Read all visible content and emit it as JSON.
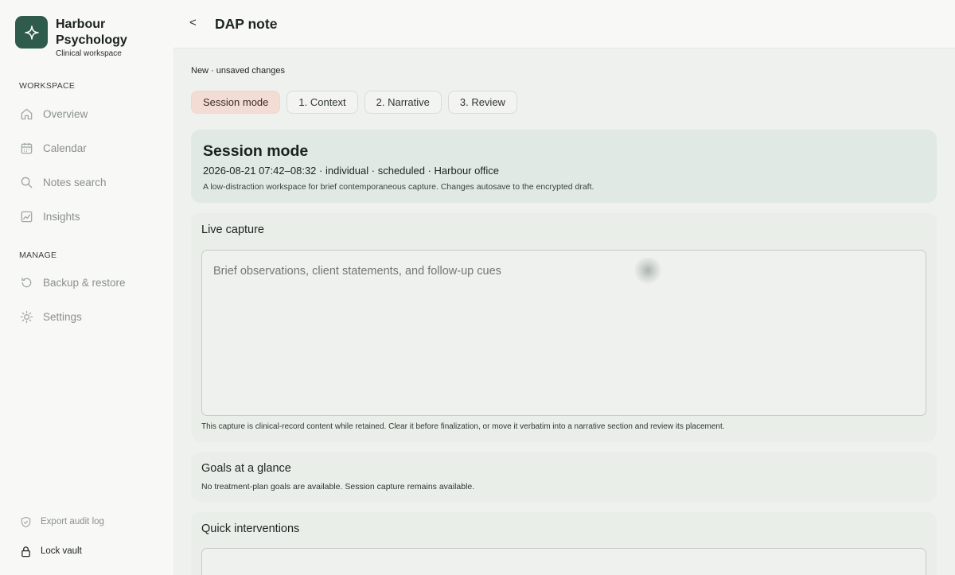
{
  "brand": {
    "name": "Harbour Psychology",
    "subtitle": "Clinical workspace",
    "logo_icon": "sparkle-icon",
    "logo_color": "#2f5b4d"
  },
  "sidebar": {
    "workspace_label": "WORKSPACE",
    "workspace_items": [
      {
        "label": "Overview",
        "icon": "home-icon"
      },
      {
        "label": "Calendar",
        "icon": "calendar-icon"
      },
      {
        "label": "Notes search",
        "icon": "search-icon"
      },
      {
        "label": "Insights",
        "icon": "chart-icon"
      }
    ],
    "manage_label": "MANAGE",
    "manage_items": [
      {
        "label": "Backup & restore",
        "icon": "restore-icon"
      },
      {
        "label": "Settings",
        "icon": "gear-icon"
      }
    ],
    "footer": {
      "export_label": "Export audit log",
      "lock_label": "Lock vault"
    }
  },
  "header": {
    "back_label": "<",
    "title": "DAP note"
  },
  "status": "New · unsaved changes",
  "tabs": [
    {
      "label": "Session mode",
      "active": true
    },
    {
      "label": "1. Context",
      "active": false
    },
    {
      "label": "2. Narrative",
      "active": false
    },
    {
      "label": "3. Review",
      "active": false
    }
  ],
  "session": {
    "title": "Session mode",
    "meta": "2026-08-21 07:42–08:32 · individual · scheduled · Harbour office",
    "description": "A low-distraction workspace for brief contemporaneous capture. Changes autosave to the encrypted draft."
  },
  "capture": {
    "title": "Live capture",
    "placeholder": "Brief observations, client statements, and follow-up cues",
    "value": "",
    "note": "This capture is clinical-record content while retained. Clear it before finalization, or move it verbatim into a narrative section and review its placement."
  },
  "goals": {
    "title": "Goals at a glance",
    "text": "No treatment-plan goals are available. Session capture remains available."
  },
  "quick": {
    "title": "Quick interventions"
  },
  "colors": {
    "accent": "#2f5b4d",
    "active_tab": "#f3dcd3",
    "session_card": "#e1e9e4"
  }
}
